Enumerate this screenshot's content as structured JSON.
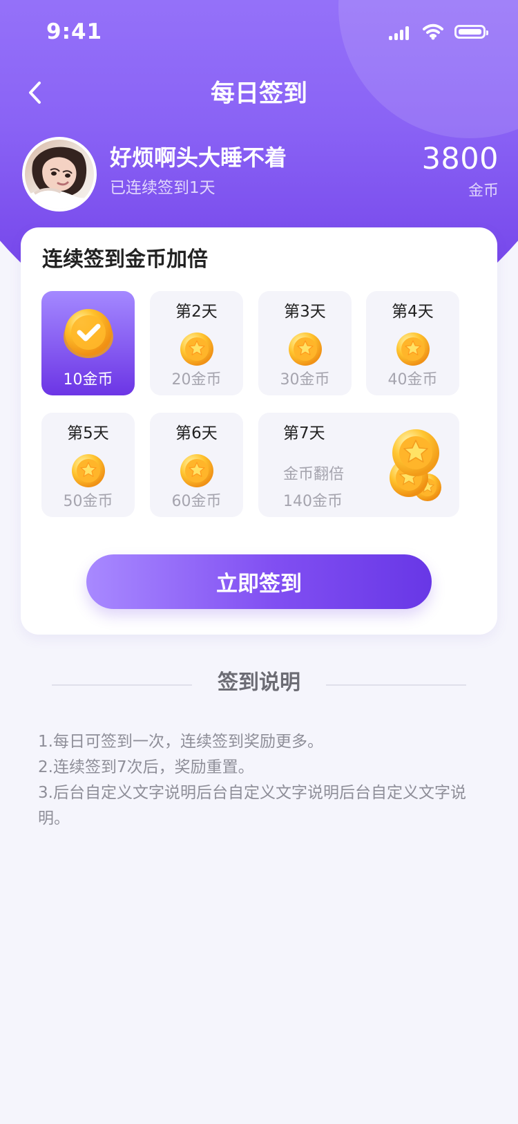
{
  "status_bar": {
    "time": "9:41",
    "icons": [
      "signal-icon",
      "wifi-icon",
      "battery-icon"
    ]
  },
  "header": {
    "title": "每日签到",
    "back_icon": "back-arrow-icon"
  },
  "profile": {
    "nickname": "好烦啊头大睡不着",
    "streak_text": "已连续签到1天",
    "coin_total": "3800",
    "coin_unit": "金币",
    "avatar_icon": "user-avatar"
  },
  "checkin_card": {
    "title": "连续签到金币加倍",
    "days": [
      {
        "day": "",
        "reward": "10金币",
        "active": true,
        "icon": "checked-coin-icon"
      },
      {
        "day": "第2天",
        "reward": "20金币",
        "active": false,
        "icon": "star-coin-icon"
      },
      {
        "day": "第3天",
        "reward": "30金币",
        "active": false,
        "icon": "star-coin-icon"
      },
      {
        "day": "第4天",
        "reward": "40金币",
        "active": false,
        "icon": "star-coin-icon"
      },
      {
        "day": "第5天",
        "reward": "50金币",
        "active": false,
        "icon": "star-coin-icon"
      },
      {
        "day": "第6天",
        "reward": "60金币",
        "active": false,
        "icon": "star-coin-icon"
      },
      {
        "day": "第7天",
        "bonus": "金币翻倍",
        "reward": "140金币",
        "active": false,
        "icon": "coin-stack-icon"
      }
    ],
    "button_label": "立即签到"
  },
  "rules": {
    "title": "签到说明",
    "items": [
      "1.每日可签到一次，连续签到奖励更多。",
      "2.连续签到7次后，奖励重置。",
      "3.后台自定义文字说明后台自定义文字说明后台自定义文字说明。"
    ]
  },
  "colors": {
    "primary": "#7a4ef0",
    "primary_light": "#a486ff",
    "background": "#f5f5fc",
    "coin": "#f6b51d"
  }
}
